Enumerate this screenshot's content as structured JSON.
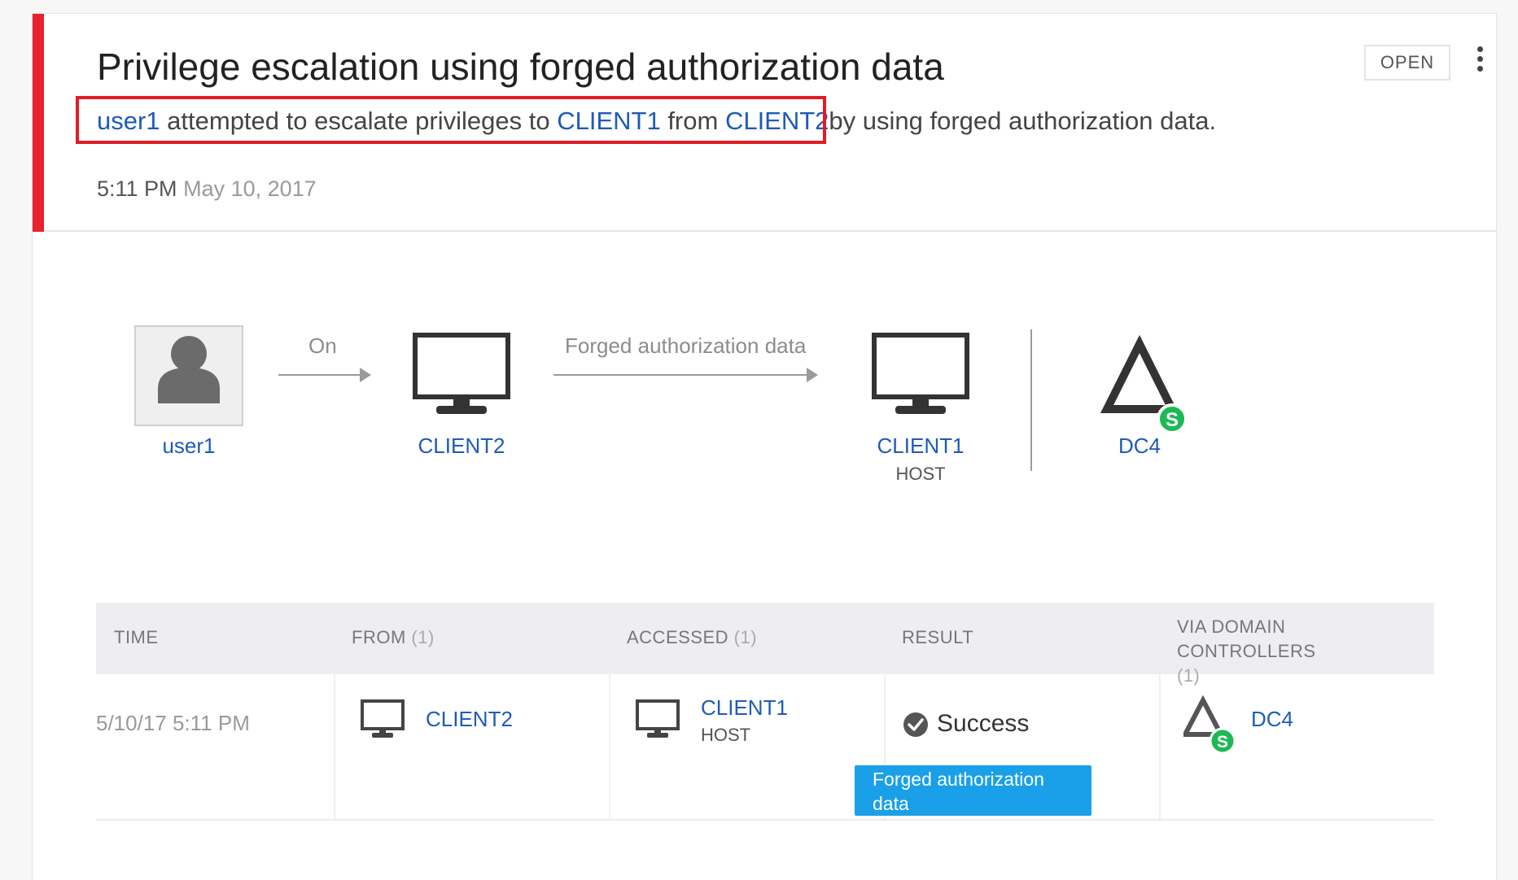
{
  "alert": {
    "title": "Privilege escalation using forged authorization data",
    "description": {
      "user": "user1",
      "part1": " attempted to escalate privileges to ",
      "target": "CLIENT1",
      "part2": " from ",
      "source": "CLIENT2",
      "part3": "by using forged authorization data."
    },
    "time": "5:11 PM",
    "date": "May 10, 2017",
    "status": "OPEN",
    "severity_color": "#e8222e"
  },
  "flow": {
    "user": {
      "label": "user1",
      "icon": "user-icon"
    },
    "arrow1_label": "On",
    "source": {
      "label": "CLIENT2",
      "icon": "monitor-icon"
    },
    "arrow2_label": "Forged authorization data",
    "target": {
      "label": "CLIENT1",
      "sublabel": "HOST",
      "icon": "monitor-icon"
    },
    "dc": {
      "label": "DC4",
      "icon": "domain-controller-icon",
      "badge": "S"
    }
  },
  "table": {
    "headers": {
      "time": "TIME",
      "from": "FROM",
      "from_count": "(1)",
      "accessed": "ACCESSED",
      "accessed_count": "(1)",
      "result": "RESULT",
      "via": "VIA DOMAIN CONTROLLERS",
      "via_count": "(1)"
    },
    "rows": [
      {
        "time": "5/10/17 5:11 PM",
        "from": "CLIENT2",
        "accessed": "CLIENT1",
        "accessed_sub": "HOST",
        "result": "Success",
        "result_tag": "Forged authorization data",
        "via": "DC4",
        "via_badge": "S"
      }
    ]
  },
  "colors": {
    "link": "#1e5bb8",
    "tag_bg": "#1aa0e8",
    "badge_green": "#1db954",
    "highlight": "#e21b24"
  }
}
